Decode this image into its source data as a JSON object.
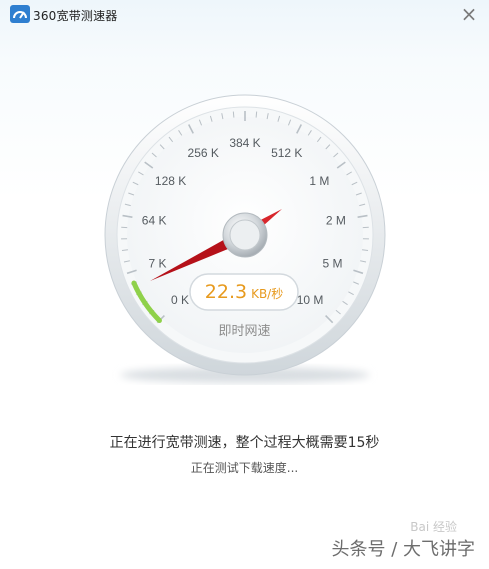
{
  "app": {
    "title": "360宽带测速器",
    "close_symbol": "×"
  },
  "gauge": {
    "scale_labels": [
      "0 K",
      "7 K",
      "64 K",
      "128 K",
      "256 K",
      "384 K",
      "512 K",
      "1 M",
      "2 M",
      "5 M",
      "10 M"
    ],
    "caption": "即时网速",
    "speed_value": "22.3",
    "speed_unit": "KB/秒",
    "progress_fraction": 0.08
  },
  "status": {
    "main": "正在进行宽带测速，整个过程大概需要15秒",
    "sub": "正在测试下载速度..."
  },
  "watermark": {
    "text": "头条号 / 大飞讲字",
    "baidu": "Bai 经验"
  },
  "colors": {
    "accent": "#e79a1e",
    "needle": "#c8141e",
    "progress": "#8fd14a"
  }
}
